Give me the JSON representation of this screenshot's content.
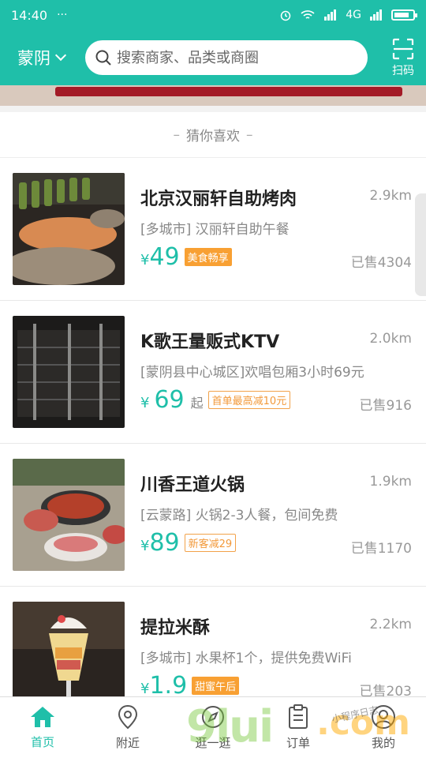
{
  "status_bar": {
    "time": "14:40",
    "dots": "···",
    "network": "4G"
  },
  "header": {
    "city": "蒙阴",
    "search_placeholder": "搜索商家、品类或商圈",
    "scan_label": "扫码"
  },
  "section": {
    "title": "猜你喜欢",
    "dash": "–"
  },
  "items": [
    {
      "name": "北京汉丽轩自助烤肉",
      "distance": "2.9km",
      "desc": "[多城市] 汉丽轩自助午餐",
      "yen": "¥",
      "price": "49",
      "unit": "",
      "tag": "美食畅享",
      "tag_style": "solid",
      "sold": "已售4304"
    },
    {
      "name": "K歌王量贩式KTV",
      "distance": "2.0km",
      "desc": "[蒙阴县中心城区]欢唱包厢3小时69元",
      "yen": "¥",
      "price": "69",
      "unit": "起",
      "tag": "首单最高减10元",
      "tag_style": "outline",
      "sold": "已售916"
    },
    {
      "name": "川香王道火锅",
      "distance": "1.9km",
      "desc": "[云蒙路] 火锅2-3人餐，包间免费",
      "yen": "¥",
      "price": "89",
      "unit": "",
      "tag": "新客减29",
      "tag_style": "outline",
      "sold": "已售1170"
    },
    {
      "name": "提拉米酥",
      "distance": "2.2km",
      "desc": "[多城市] 水果杯1个，提供免费WiFi",
      "yen": "¥",
      "price": "1.9",
      "unit": "",
      "tag": "甜蜜午后",
      "tag_style": "solid",
      "sold": "已售203"
    }
  ],
  "nav": [
    {
      "label": "首页",
      "icon": "home-icon"
    },
    {
      "label": "附近",
      "icon": "location-pin-icon"
    },
    {
      "label": "逛一逛",
      "icon": "browse-icon"
    },
    {
      "label": "订单",
      "icon": "order-clipboard-icon"
    },
    {
      "label": "我的",
      "icon": "user-profile-icon"
    }
  ],
  "watermark": {
    "left": "9lui",
    "right": ".com",
    "handwriting": "小程序日志"
  },
  "colors": {
    "accent": "#1fbfa9",
    "tag_orange": "#f8a033"
  }
}
